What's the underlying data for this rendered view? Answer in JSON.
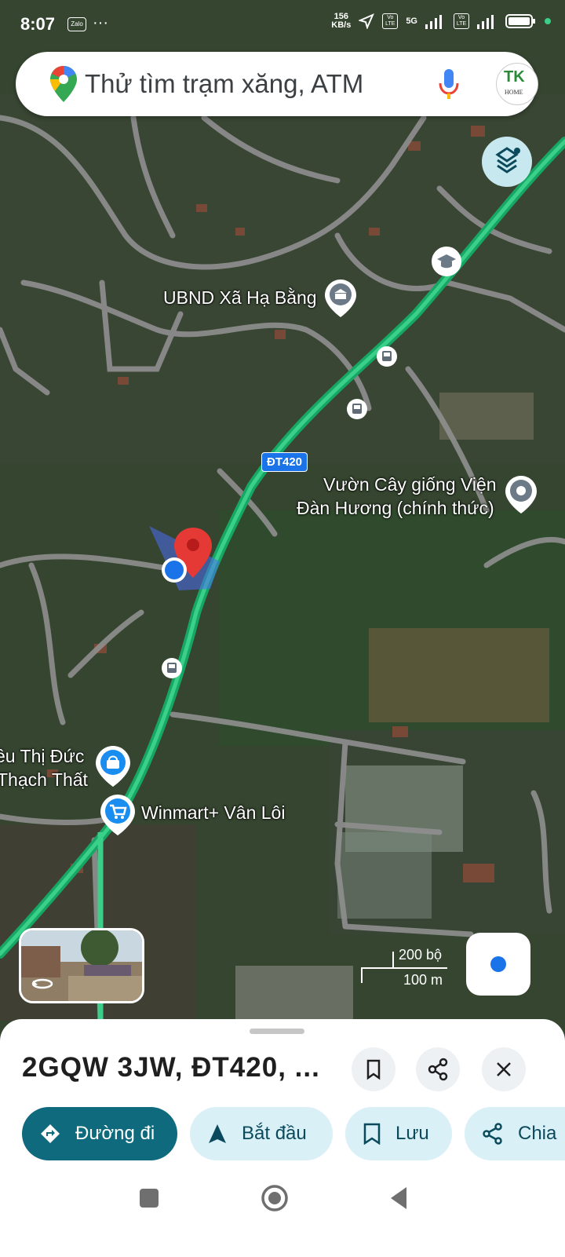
{
  "status_bar": {
    "time": "8:07",
    "app_icon": "Zalo",
    "more": "···",
    "speed": "156",
    "speed_unit": "KB/s",
    "network": "5G",
    "volte1": "Vo LTE",
    "volte2": "Vo LTE"
  },
  "search": {
    "placeholder": "Thử tìm trạm xăng, ATM",
    "avatar_text": "TK",
    "avatar_sub": "HOME"
  },
  "map": {
    "labels": {
      "ubnd": "UBND Xã Hạ Bằng",
      "garden_line1": "Vườn Cây giống Viện",
      "garden_line2": "Đàn Hương (chính thức)",
      "store_line1": "ều Thị Đức",
      "store_line2": "Thạch Thất",
      "winmart": "Winmart+ Vân Lôi",
      "route": "ĐT420"
    },
    "scale": {
      "top": "200 bộ",
      "bottom": "100 m"
    },
    "colors": {
      "route": "#22c07a",
      "pin": "#e53935",
      "location": "#1a73e8"
    }
  },
  "sheet": {
    "title": "2GQW 3JW, ĐT420, ...",
    "actions": [
      {
        "label": "Đường đi",
        "icon": "directions-icon"
      },
      {
        "label": "Bắt đầu",
        "icon": "navigation-icon"
      },
      {
        "label": "Lưu",
        "icon": "bookmark-icon"
      },
      {
        "label": "Chia",
        "icon": "share-icon"
      }
    ]
  }
}
